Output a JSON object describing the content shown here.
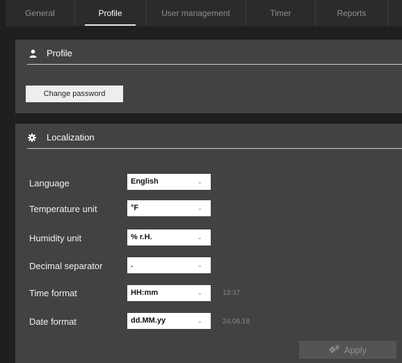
{
  "tabs": [
    {
      "label": "General",
      "active": false
    },
    {
      "label": "Profile",
      "active": true
    },
    {
      "label": "User management",
      "active": false
    },
    {
      "label": "Timer",
      "active": false
    },
    {
      "label": "Reports",
      "active": false
    }
  ],
  "profile": {
    "title": "Profile",
    "icon": "user-icon",
    "change_password_label": "Change password"
  },
  "localization": {
    "title": "Localization",
    "icon": "gear-icon",
    "rows": [
      {
        "label": "Language",
        "value": "English",
        "sample": ""
      },
      {
        "label": "Temperature unit",
        "value": "°F",
        "sample": ""
      },
      {
        "label": "Humidity unit",
        "value": "% r.H.",
        "sample": ""
      },
      {
        "label": "Decimal separator",
        "value": ".",
        "sample": ""
      },
      {
        "label": "Time format",
        "value": "HH:mm",
        "sample": "13:37"
      },
      {
        "label": "Date format",
        "value": "dd.MM.yy",
        "sample": "24.06.18"
      }
    ],
    "apply_label": "Apply",
    "apply_icon": "gears-icon"
  },
  "colors": {
    "background": "#1f1f1f",
    "panel": "#424242",
    "tabbar": "#2b2b2b",
    "apply_disabled": "#545454"
  }
}
